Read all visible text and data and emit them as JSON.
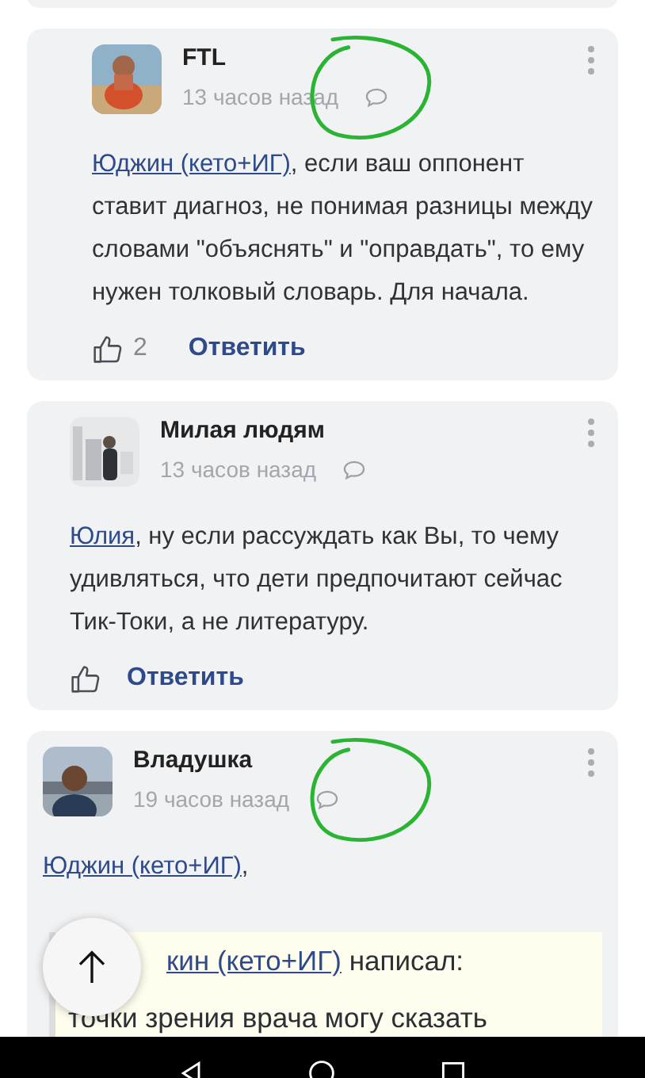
{
  "comments": [
    {
      "kind": "nested-reply",
      "author": "FTL",
      "time": "13 часов назад",
      "circled": true,
      "body": {
        "mention": "Юджин (кето+ИГ)",
        "text": ", если ваш оппонент ставит диагноз, не понимая разницы между словами \"объяснять\" и \"оправдать\", то ему нужен толковый словарь. Для начала."
      },
      "likes": "2",
      "reply": "Ответить"
    },
    {
      "kind": "reply",
      "author": "Милая людям",
      "time": "13 часов назад",
      "circled": false,
      "body": {
        "mention": "Юлия",
        "text": ", ну если рассуждать как Вы, то чему удивляться, что дети предпочитают сейчас Тик-Токи, а не литературу."
      },
      "reply": "Ответить"
    },
    {
      "kind": "comment",
      "author": "Владушка",
      "time": "19 часов назад",
      "circled": true,
      "body": {
        "mention": "Юджин (кето+ИГ)",
        "text": ","
      },
      "quote": {
        "link": "кин (кето+ИГ)",
        "text": " написал:",
        "lines": [
          "точки зрения врача могу сказать"
        ]
      }
    }
  ]
}
